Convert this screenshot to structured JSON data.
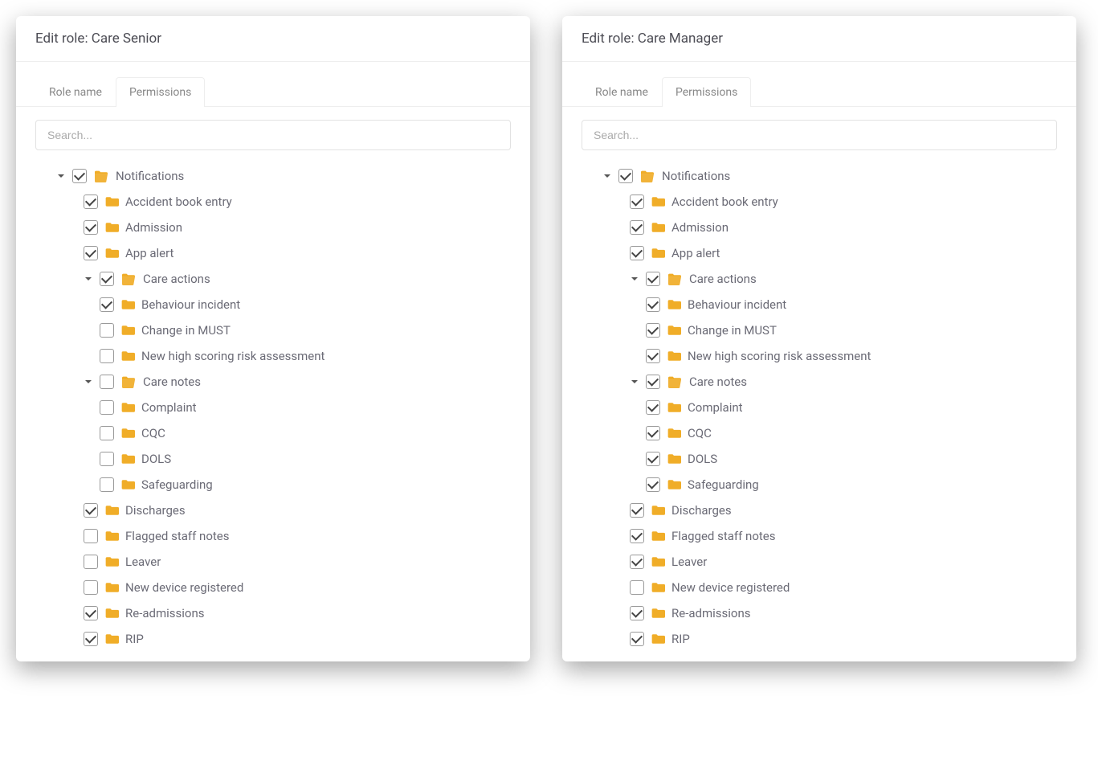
{
  "tabs": {
    "role_name": "Role name",
    "permissions": "Permissions"
  },
  "search_placeholder": "Search...",
  "colors": {
    "folder": "#f0ad28"
  },
  "panels": [
    {
      "title": "Edit role: Care Senior",
      "tree": [
        {
          "level": 0,
          "expanded": true,
          "checked": true,
          "folder": "open",
          "label": "Notifications"
        },
        {
          "level": 1,
          "expanded": null,
          "checked": true,
          "folder": "closed",
          "label": "Accident book entry"
        },
        {
          "level": 1,
          "expanded": null,
          "checked": true,
          "folder": "closed",
          "label": "Admission"
        },
        {
          "level": 1,
          "expanded": null,
          "checked": true,
          "folder": "closed",
          "label": "App alert"
        },
        {
          "level": 1,
          "expanded": true,
          "checked": true,
          "folder": "open",
          "label": "Care actions"
        },
        {
          "level": 2,
          "expanded": null,
          "checked": true,
          "folder": "closed",
          "label": "Behaviour incident"
        },
        {
          "level": 2,
          "expanded": null,
          "checked": false,
          "folder": "closed",
          "label": "Change in MUST"
        },
        {
          "level": 2,
          "expanded": null,
          "checked": false,
          "folder": "closed",
          "label": "New high scoring risk assessment"
        },
        {
          "level": 1,
          "expanded": true,
          "checked": false,
          "folder": "open",
          "label": "Care notes"
        },
        {
          "level": 2,
          "expanded": null,
          "checked": false,
          "folder": "closed",
          "label": "Complaint"
        },
        {
          "level": 2,
          "expanded": null,
          "checked": false,
          "folder": "closed",
          "label": "CQC"
        },
        {
          "level": 2,
          "expanded": null,
          "checked": false,
          "folder": "closed",
          "label": "DOLS"
        },
        {
          "level": 2,
          "expanded": null,
          "checked": false,
          "folder": "closed",
          "label": "Safeguarding"
        },
        {
          "level": 1,
          "expanded": null,
          "checked": true,
          "folder": "closed",
          "label": "Discharges"
        },
        {
          "level": 1,
          "expanded": null,
          "checked": false,
          "folder": "closed",
          "label": "Flagged staff notes"
        },
        {
          "level": 1,
          "expanded": null,
          "checked": false,
          "folder": "closed",
          "label": "Leaver"
        },
        {
          "level": 1,
          "expanded": null,
          "checked": false,
          "folder": "closed",
          "label": "New device registered"
        },
        {
          "level": 1,
          "expanded": null,
          "checked": true,
          "folder": "closed",
          "label": "Re-admissions"
        },
        {
          "level": 1,
          "expanded": null,
          "checked": true,
          "folder": "closed",
          "label": "RIP"
        }
      ]
    },
    {
      "title": "Edit role: Care Manager",
      "tree": [
        {
          "level": 0,
          "expanded": true,
          "checked": true,
          "folder": "open",
          "label": "Notifications"
        },
        {
          "level": 1,
          "expanded": null,
          "checked": true,
          "folder": "closed",
          "label": "Accident book entry"
        },
        {
          "level": 1,
          "expanded": null,
          "checked": true,
          "folder": "closed",
          "label": "Admission"
        },
        {
          "level": 1,
          "expanded": null,
          "checked": true,
          "folder": "closed",
          "label": "App alert"
        },
        {
          "level": 1,
          "expanded": true,
          "checked": true,
          "folder": "open",
          "label": "Care actions"
        },
        {
          "level": 2,
          "expanded": null,
          "checked": true,
          "folder": "closed",
          "label": "Behaviour incident"
        },
        {
          "level": 2,
          "expanded": null,
          "checked": true,
          "folder": "closed",
          "label": "Change in MUST"
        },
        {
          "level": 2,
          "expanded": null,
          "checked": true,
          "folder": "closed",
          "label": "New high scoring risk assessment"
        },
        {
          "level": 1,
          "expanded": true,
          "checked": true,
          "folder": "open",
          "label": "Care notes"
        },
        {
          "level": 2,
          "expanded": null,
          "checked": true,
          "folder": "closed",
          "label": "Complaint"
        },
        {
          "level": 2,
          "expanded": null,
          "checked": true,
          "folder": "closed",
          "label": "CQC"
        },
        {
          "level": 2,
          "expanded": null,
          "checked": true,
          "folder": "closed",
          "label": "DOLS"
        },
        {
          "level": 2,
          "expanded": null,
          "checked": true,
          "folder": "closed",
          "label": "Safeguarding"
        },
        {
          "level": 1,
          "expanded": null,
          "checked": true,
          "folder": "closed",
          "label": "Discharges"
        },
        {
          "level": 1,
          "expanded": null,
          "checked": true,
          "folder": "closed",
          "label": "Flagged staff notes"
        },
        {
          "level": 1,
          "expanded": null,
          "checked": true,
          "folder": "closed",
          "label": "Leaver"
        },
        {
          "level": 1,
          "expanded": null,
          "checked": false,
          "folder": "closed",
          "label": "New device registered"
        },
        {
          "level": 1,
          "expanded": null,
          "checked": true,
          "folder": "closed",
          "label": "Re-admissions"
        },
        {
          "level": 1,
          "expanded": null,
          "checked": true,
          "folder": "closed",
          "label": "RIP"
        }
      ]
    }
  ]
}
